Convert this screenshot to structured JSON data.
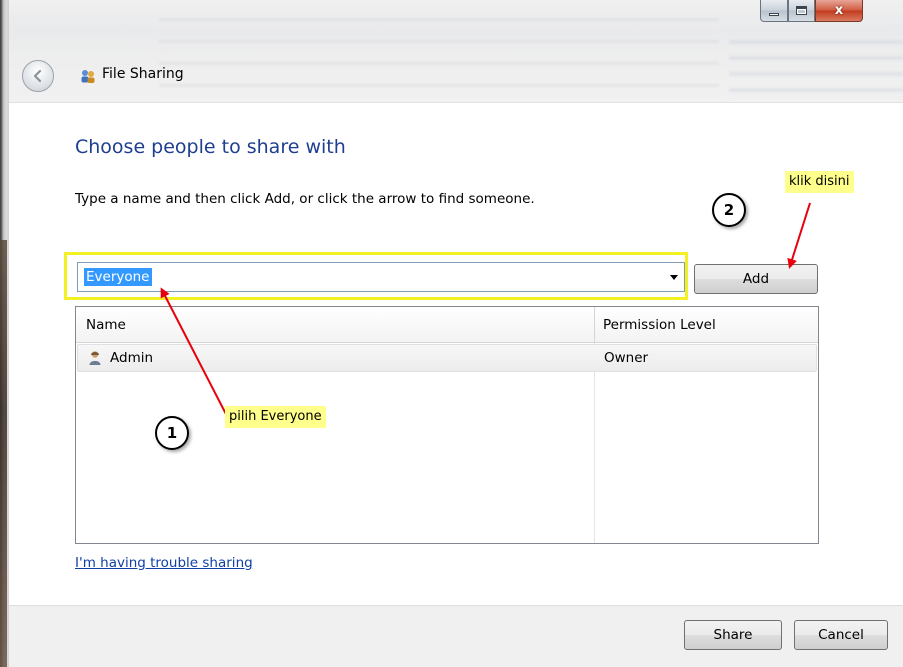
{
  "window": {
    "title": "File Sharing",
    "caption_close": "x"
  },
  "dialog": {
    "heading": "Choose people to share with",
    "instruction": "Type a name and then click Add, or click the arrow to find someone.",
    "name_input_value": "Everyone",
    "add_label": "Add",
    "table": {
      "columns": [
        "Name",
        "Permission Level"
      ],
      "rows": [
        {
          "name": "Admin",
          "permission": "Owner",
          "icon": "user-icon"
        }
      ]
    },
    "help_link": "I'm having trouble sharing",
    "share_label": "Share",
    "cancel_label": "Cancel"
  },
  "annotations": {
    "callout_2": "klik disini",
    "step_2": "2",
    "callout_1": "pilih Everyone",
    "step_1": "1",
    "highlight_color": "#f4f123",
    "arrow_color": "#e8000c"
  }
}
